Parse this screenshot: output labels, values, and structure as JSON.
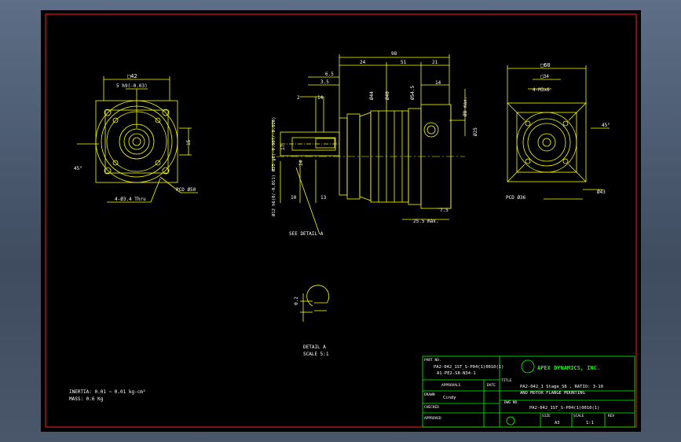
{
  "colors": {
    "background": "#000000",
    "geometry": "#ffff00",
    "text": "#ffffff",
    "title_block": "#00ff00",
    "frame": "#ff0000",
    "dim": "#ffff00"
  },
  "front_view": {
    "square": "□42",
    "thread": "5 h9(-0.03)",
    "angle": "45°",
    "holes": "4-Ø3.4 Thru",
    "pcd": "PCD Ø50",
    "dim_right": "15"
  },
  "side_view": {
    "total_length": "98",
    "d24": "24",
    "d51": "51",
    "d21": "21",
    "d6_5": "6.5",
    "d3_5": "3.5",
    "d2": "2",
    "d14a": "14",
    "d14b": "14",
    "d44": "Ø44",
    "d40": "Ø40",
    "d54_5": "Ø54.5",
    "d8_max": "Ø8 max.",
    "d25_right": "Ø25",
    "d16_5": "16.5",
    "d17": "17",
    "d14": "14",
    "d13": "13",
    "d10": "10",
    "d25_h7": "Ø25 g6(-0.007/-0.020)",
    "d12_h6": "Ø12 h6(0/-0.011)",
    "d25_5": "25.5 max.",
    "d7_5": "7.5",
    "detail_label": "SEE DETAIL A"
  },
  "rear_view": {
    "square": "□60",
    "sq34": "□34",
    "holes": "4-M3x6",
    "angle": "45°",
    "pcd": "PCD Ø36",
    "dia": "Ø43"
  },
  "detail": {
    "dim": "0.2",
    "title": "DETAIL A",
    "scale": "SCALE 5:1"
  },
  "notes": {
    "inertia": "INERTIA: 0.01 ~ 0.01 kg-cm²",
    "mass": "MASS: 0.6  Kg"
  },
  "title_block": {
    "part_no_label": "PART NO.",
    "part_no": "PA2-042_1ST_S-P04(1)0010(1)",
    "part_no2": "A1-PE2-S8-N34-1",
    "company": "APEX DYNAMICS, INC.",
    "approvals": "APPROVALS",
    "date": "DATE",
    "title_label": "TITLE",
    "title1": "PA2-042_1 Stage_S8 , RATIO: 3-10",
    "title2": "AND MOTOR FLANGE MOUNTING",
    "drawn_label": "DRAWN",
    "drawn": "Cindy",
    "checked_label": "CHECKED",
    "dwg_label": "DWG NO.",
    "dwg_no": "PA2-042_1ST_S-P04(1)0010(1)",
    "approved_label": "APPROVED",
    "size_label": "SIZE",
    "size": "A3",
    "scale_label": "SCALE",
    "scale": "1:1",
    "rev_label": "REV"
  }
}
